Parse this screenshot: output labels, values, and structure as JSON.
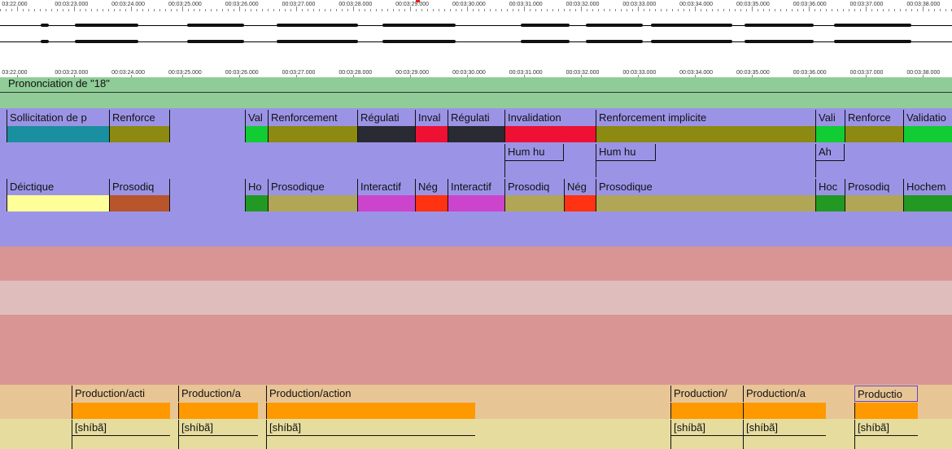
{
  "ruler": {
    "labels": [
      "03:22.000",
      "00:03:23.000",
      "00:03:24.000",
      "00:03:25.000",
      "00:03:26.000",
      "00:03:27.000",
      "00:03:28.000",
      "00:03:29.000",
      "00:03:30.000",
      "00:03:31.000",
      "00:03:32.000",
      "00:03:33.000",
      "00:03:34.000",
      "00:03:35.000",
      "00:03:36.000",
      "00:03:37.000",
      "00:03:38.000"
    ]
  },
  "tier_title": "Prononciation de \"18\"",
  "row1": [
    {
      "label": "Sollicitation de p",
      "color": "#1a8f9f"
    },
    {
      "label": "Renforce",
      "color": "#8c8a10"
    },
    {
      "label": "",
      "color": "#9b94e6"
    },
    {
      "label": "Val",
      "color": "#11cc33"
    },
    {
      "label": "Renforcement",
      "color": "#8c8a10"
    },
    {
      "label": "Régulati",
      "color": "#2a2a33"
    },
    {
      "label": "Inval",
      "color": "#ee1133"
    },
    {
      "label": "Régulati",
      "color": "#2a2a33"
    },
    {
      "label": "Invalidation",
      "color": "#ee1133"
    },
    {
      "label": "Renforcement implicite",
      "color": "#8c8a10"
    },
    {
      "label": "Vali",
      "color": "#11cc33"
    },
    {
      "label": "Renforce",
      "color": "#8c8a10"
    },
    {
      "label": "Validatio",
      "color": "#11cc33"
    }
  ],
  "row2": [
    {
      "label": "Hum hu"
    },
    {
      "label": "Hum hu"
    },
    {
      "label": "Ah"
    }
  ],
  "row3": [
    {
      "label": "Déictique",
      "color": "#ffff99"
    },
    {
      "label": "Prosodiq",
      "color": "#b8552a"
    },
    {
      "label": "",
      "color": "#9b94e6"
    },
    {
      "label": "Ho",
      "color": "#229922"
    },
    {
      "label": "Prosodique",
      "color": "#b0a655"
    },
    {
      "label": "Interactif",
      "color": "#cc44cc"
    },
    {
      "label": "Nég",
      "color": "#ff3311"
    },
    {
      "label": "Interactif",
      "color": "#cc44cc"
    },
    {
      "label": "Prosodiq",
      "color": "#b0a655"
    },
    {
      "label": "Nég",
      "color": "#ff3311"
    },
    {
      "label": "Prosodique",
      "color": "#b0a655"
    },
    {
      "label": "Hoc",
      "color": "#229922"
    },
    {
      "label": "Prosodiq",
      "color": "#b0a655"
    },
    {
      "label": "Hochem",
      "color": "#229922"
    }
  ],
  "row4": [
    {
      "label": "Production/acti"
    },
    {
      "label": "Production/a"
    },
    {
      "label": "Production/action"
    },
    {
      "label": "Production/"
    },
    {
      "label": "Production/a"
    },
    {
      "label": "Productio"
    }
  ],
  "row5": [
    {
      "label": "[shíbã]"
    },
    {
      "label": "[shíbã]"
    },
    {
      "label": "[shíbã]"
    },
    {
      "label": "[shíbã]"
    },
    {
      "label": "[shíbã]"
    },
    {
      "label": "[shíbã]"
    }
  ],
  "colors": {
    "tier_green": "#8fcc97",
    "purple": "#9b94e6",
    "salmon": "#d99593",
    "pink_light": "#e0bdbd",
    "orange_band": "#e8c595",
    "orange_bar": "#ff9900",
    "khaki_band": "#e6dc9e"
  }
}
